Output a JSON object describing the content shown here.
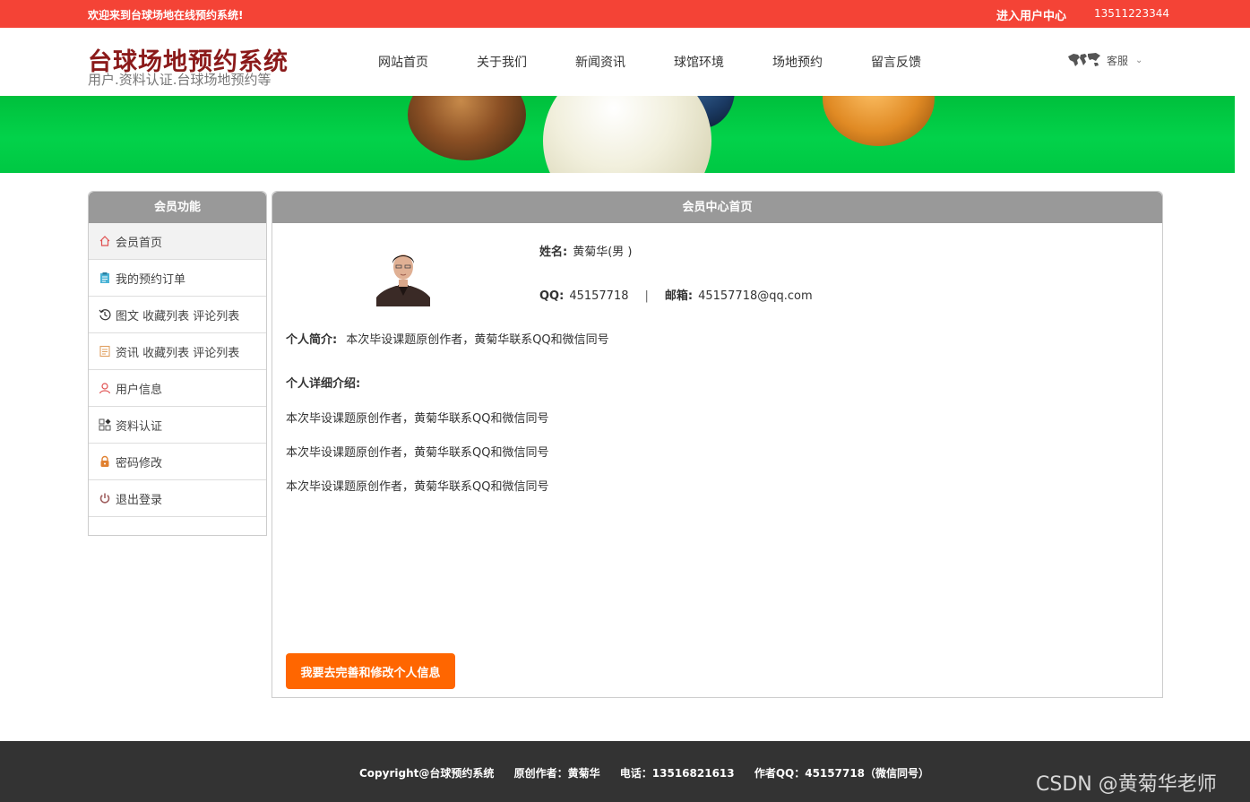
{
  "topbar": {
    "welcome": "欢迎来到台球场地在线预约系统!",
    "user_center": "进入用户中心",
    "phone": "13511223344"
  },
  "header": {
    "title": "台球场地预约系统",
    "subtitle": "用户.资料认证.台球场地预约等",
    "nav": [
      "网站首页",
      "关于我们",
      "新闻资讯",
      "球馆环境",
      "场地预约",
      "留言反馈"
    ],
    "service_label": "客服",
    "service_icon": "world-map-icon"
  },
  "sidebar": {
    "title": "会员功能",
    "items": [
      {
        "label": "会员首页",
        "icon": "home-icon"
      },
      {
        "label": "我的预约订单",
        "icon": "clipboard-icon"
      },
      {
        "label": "图文 收藏列表 评论列表",
        "icon": "history-icon"
      },
      {
        "label": "资讯 收藏列表 评论列表",
        "icon": "document-icon"
      },
      {
        "label": "用户信息",
        "icon": "user-icon"
      },
      {
        "label": "资料认证",
        "icon": "grid-icon"
      },
      {
        "label": "密码修改",
        "icon": "lock-icon"
      },
      {
        "label": "退出登录",
        "icon": "power-icon"
      }
    ]
  },
  "main": {
    "title": "会员中心首页",
    "name_label": "姓名:",
    "name_value": "黄菊华(男 )",
    "qq_label": "QQ:",
    "qq_value": "45157718",
    "separator": "|",
    "email_label": "邮箱:",
    "email_value": "45157718@qq.com",
    "intro_label": "个人简介:",
    "intro_value": "本次毕设课题原创作者，黄菊华联系QQ和微信同号",
    "detail_label": "个人详细介绍:",
    "detail_lines": [
      "本次毕设课题原创作者，黄菊华联系QQ和微信同号",
      "本次毕设课题原创作者，黄菊华联系QQ和微信同号",
      "本次毕设课题原创作者，黄菊华联系QQ和微信同号"
    ],
    "edit_button": "我要去完善和修改个人信息"
  },
  "footer": {
    "copyright": "Copyright@台球预约系统",
    "author": "原创作者：黄菊华",
    "phone": "电话：13516821613",
    "qq": "作者QQ：45157718（微信同号）"
  },
  "watermark": "CSDN @黄菊华老师",
  "colors": {
    "topbar": "#f44336",
    "brand_title": "#8b1a1a",
    "panel_header": "#999999",
    "button": "#ff6600",
    "footer": "#333333"
  }
}
